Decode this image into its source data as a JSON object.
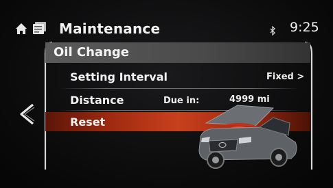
{
  "statusbar": {
    "title": "Maintenance",
    "time": "9:25"
  },
  "screen": {
    "header": "Oil Change",
    "rows": [
      {
        "label": "Setting Interval",
        "value": "Fixed >"
      },
      {
        "label": "Distance",
        "due_label": "Due in:",
        "due_value": "4999 mi"
      },
      {
        "label": "Reset"
      }
    ]
  },
  "colors": {
    "highlight": "#c8401c",
    "header_bg": "#555555",
    "text": "#f2f2f2"
  },
  "icons": [
    "home-icon",
    "app-icon",
    "bluetooth-icon",
    "back-chevron-icon",
    "car-engine-image"
  ]
}
